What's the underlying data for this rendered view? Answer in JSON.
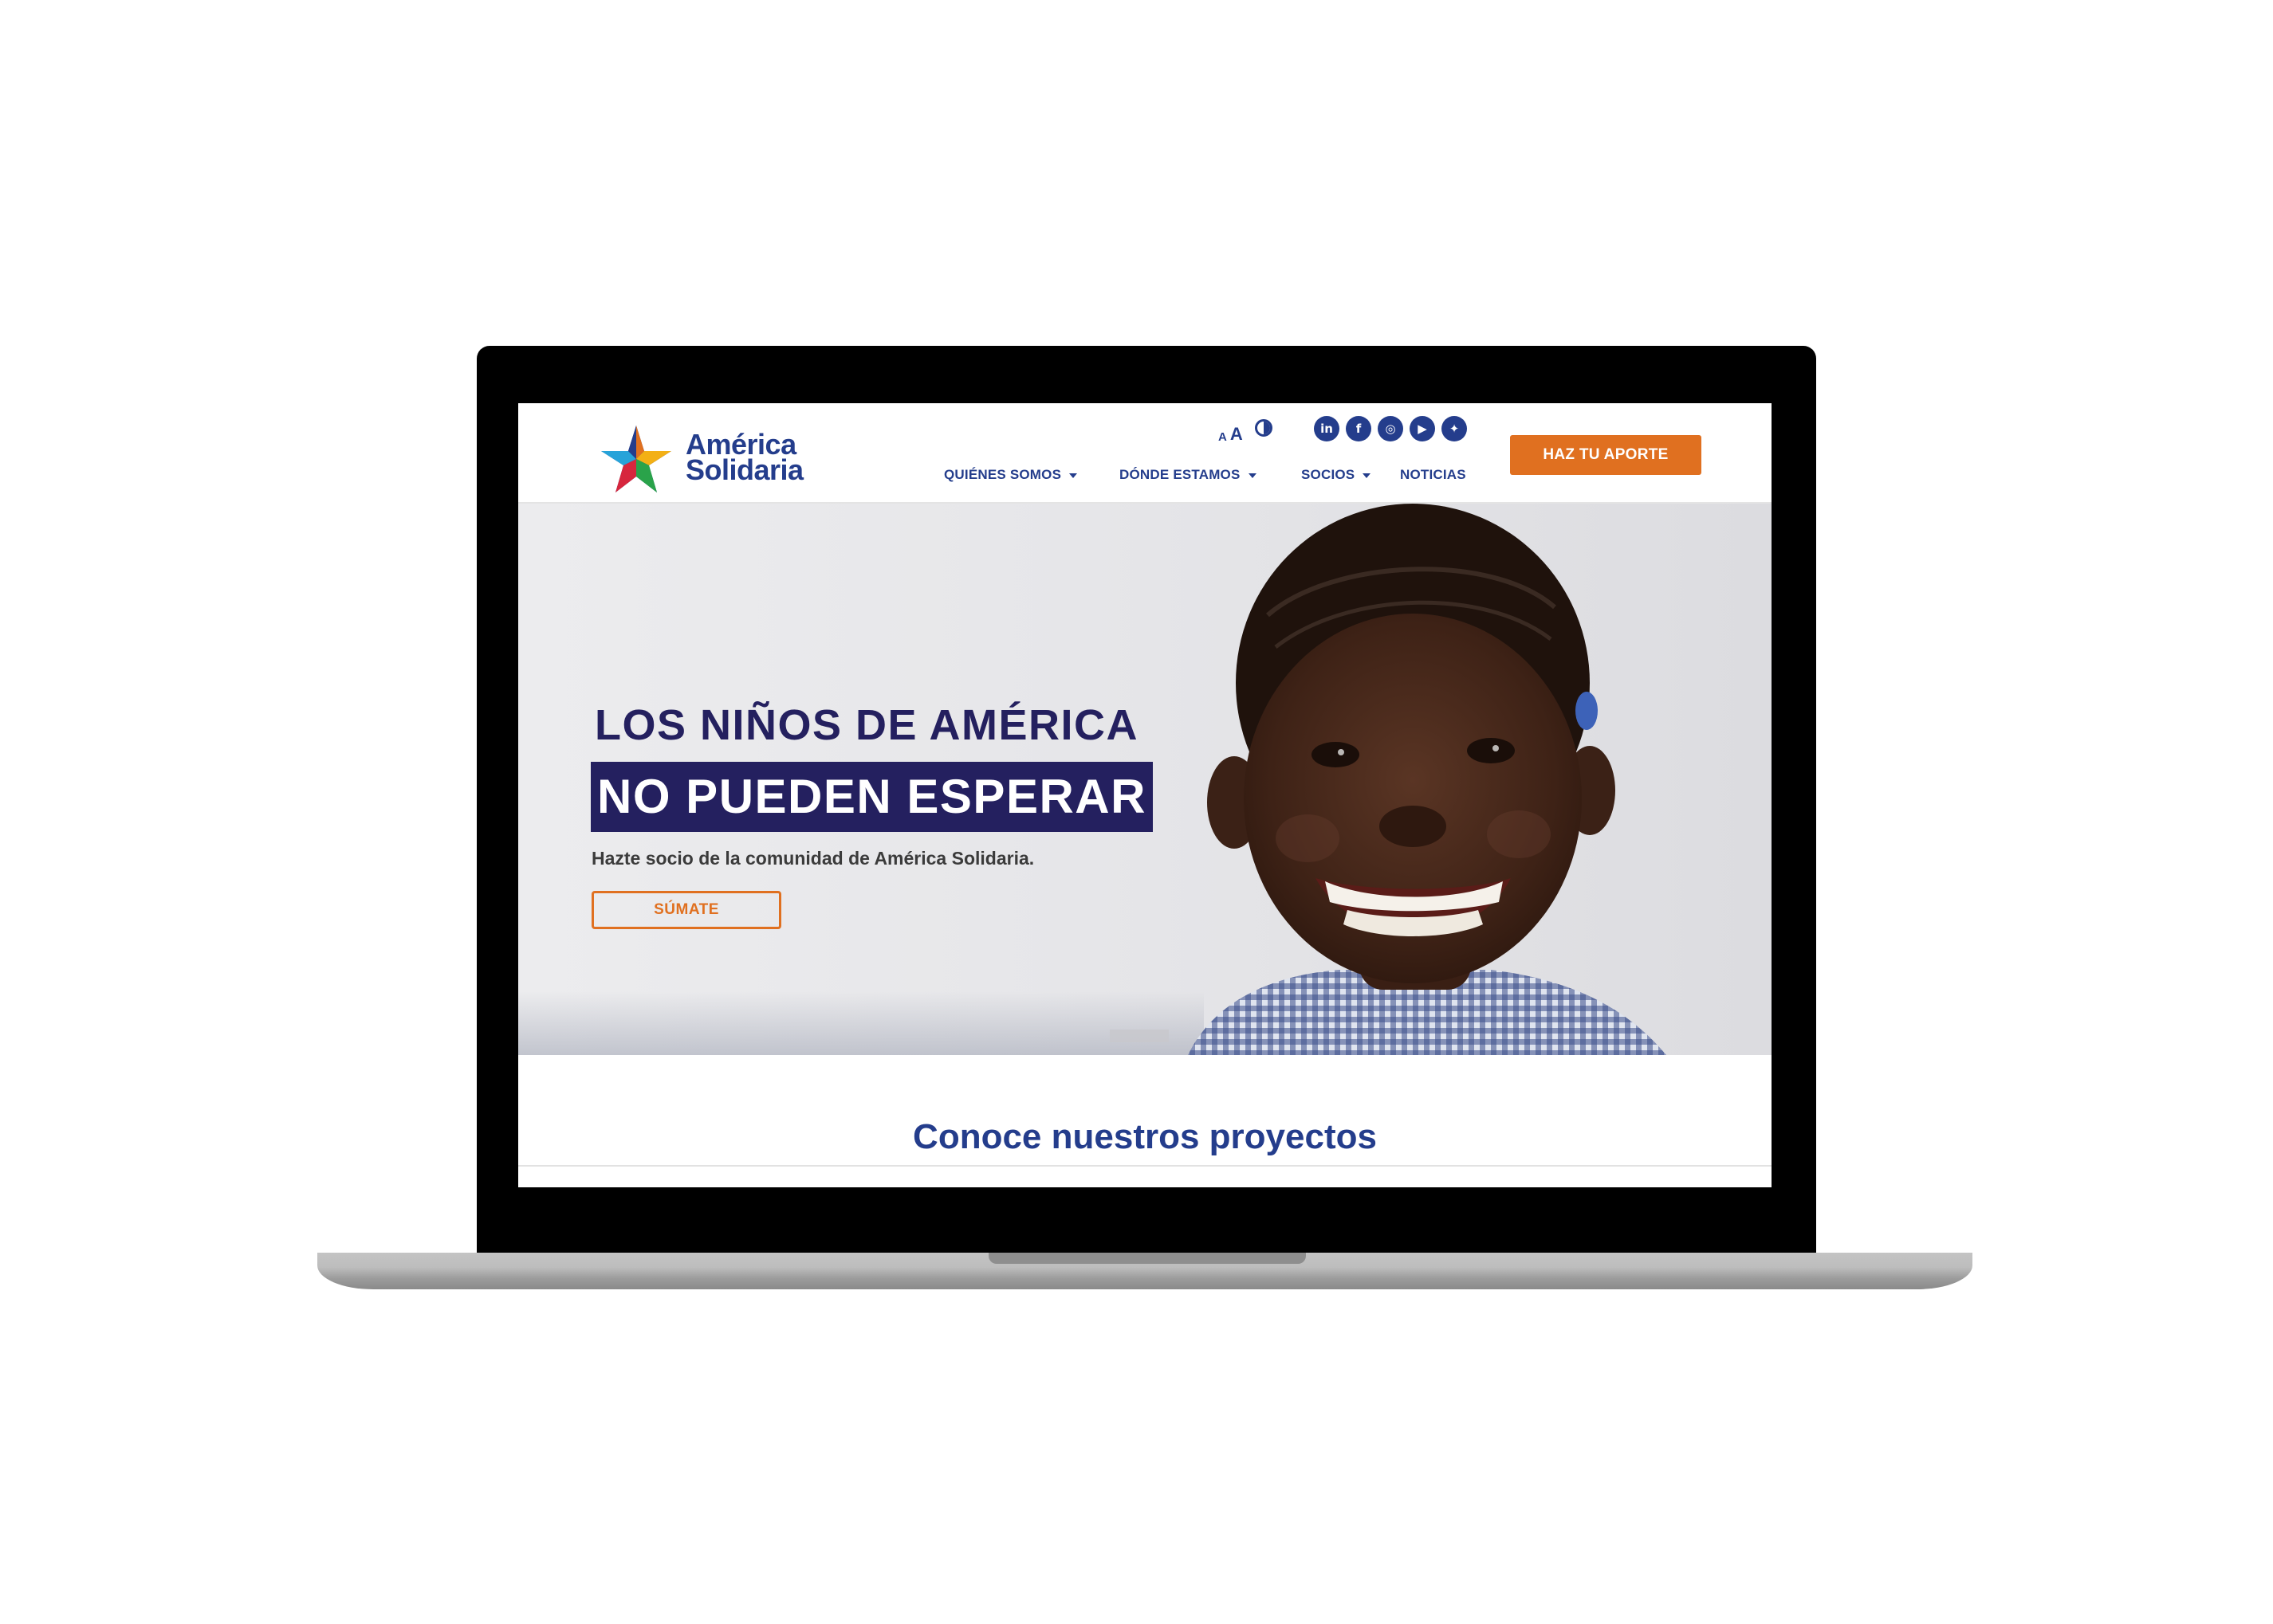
{
  "brand": {
    "name_line1": "América",
    "name_line2": "Solidaria",
    "primary_color": "#243d8c",
    "accent_color": "#e07020",
    "hero_text_color": "#24205f"
  },
  "accessibility": {
    "font_small": "A",
    "font_large": "A",
    "contrast_icon": "contrast-icon"
  },
  "social": [
    {
      "name": "linkedin-icon",
      "glyph": "in"
    },
    {
      "name": "facebook-icon",
      "glyph": "f"
    },
    {
      "name": "instagram-icon",
      "glyph": "◎"
    },
    {
      "name": "youtube-icon",
      "glyph": "▶"
    },
    {
      "name": "twitter-icon",
      "glyph": "✦"
    }
  ],
  "nav": {
    "items": [
      {
        "label": "QUIÉNES SOMOS",
        "has_dropdown": true
      },
      {
        "label": "DÓNDE ESTAMOS",
        "has_dropdown": true
      },
      {
        "label": "SOCIOS",
        "has_dropdown": true
      },
      {
        "label": "NOTICIAS",
        "has_dropdown": false
      }
    ],
    "cta_label": "HAZ TU APORTE"
  },
  "hero": {
    "title_line1": "LOS NIÑOS DE AMÉRICA",
    "title_line2": "NO PUEDEN ESPERAR",
    "subtitle": "Hazte socio de la comunidad de América Solidaria.",
    "button_label": "SÚMATE"
  },
  "projects": {
    "title": "Conoce nuestros proyectos"
  }
}
